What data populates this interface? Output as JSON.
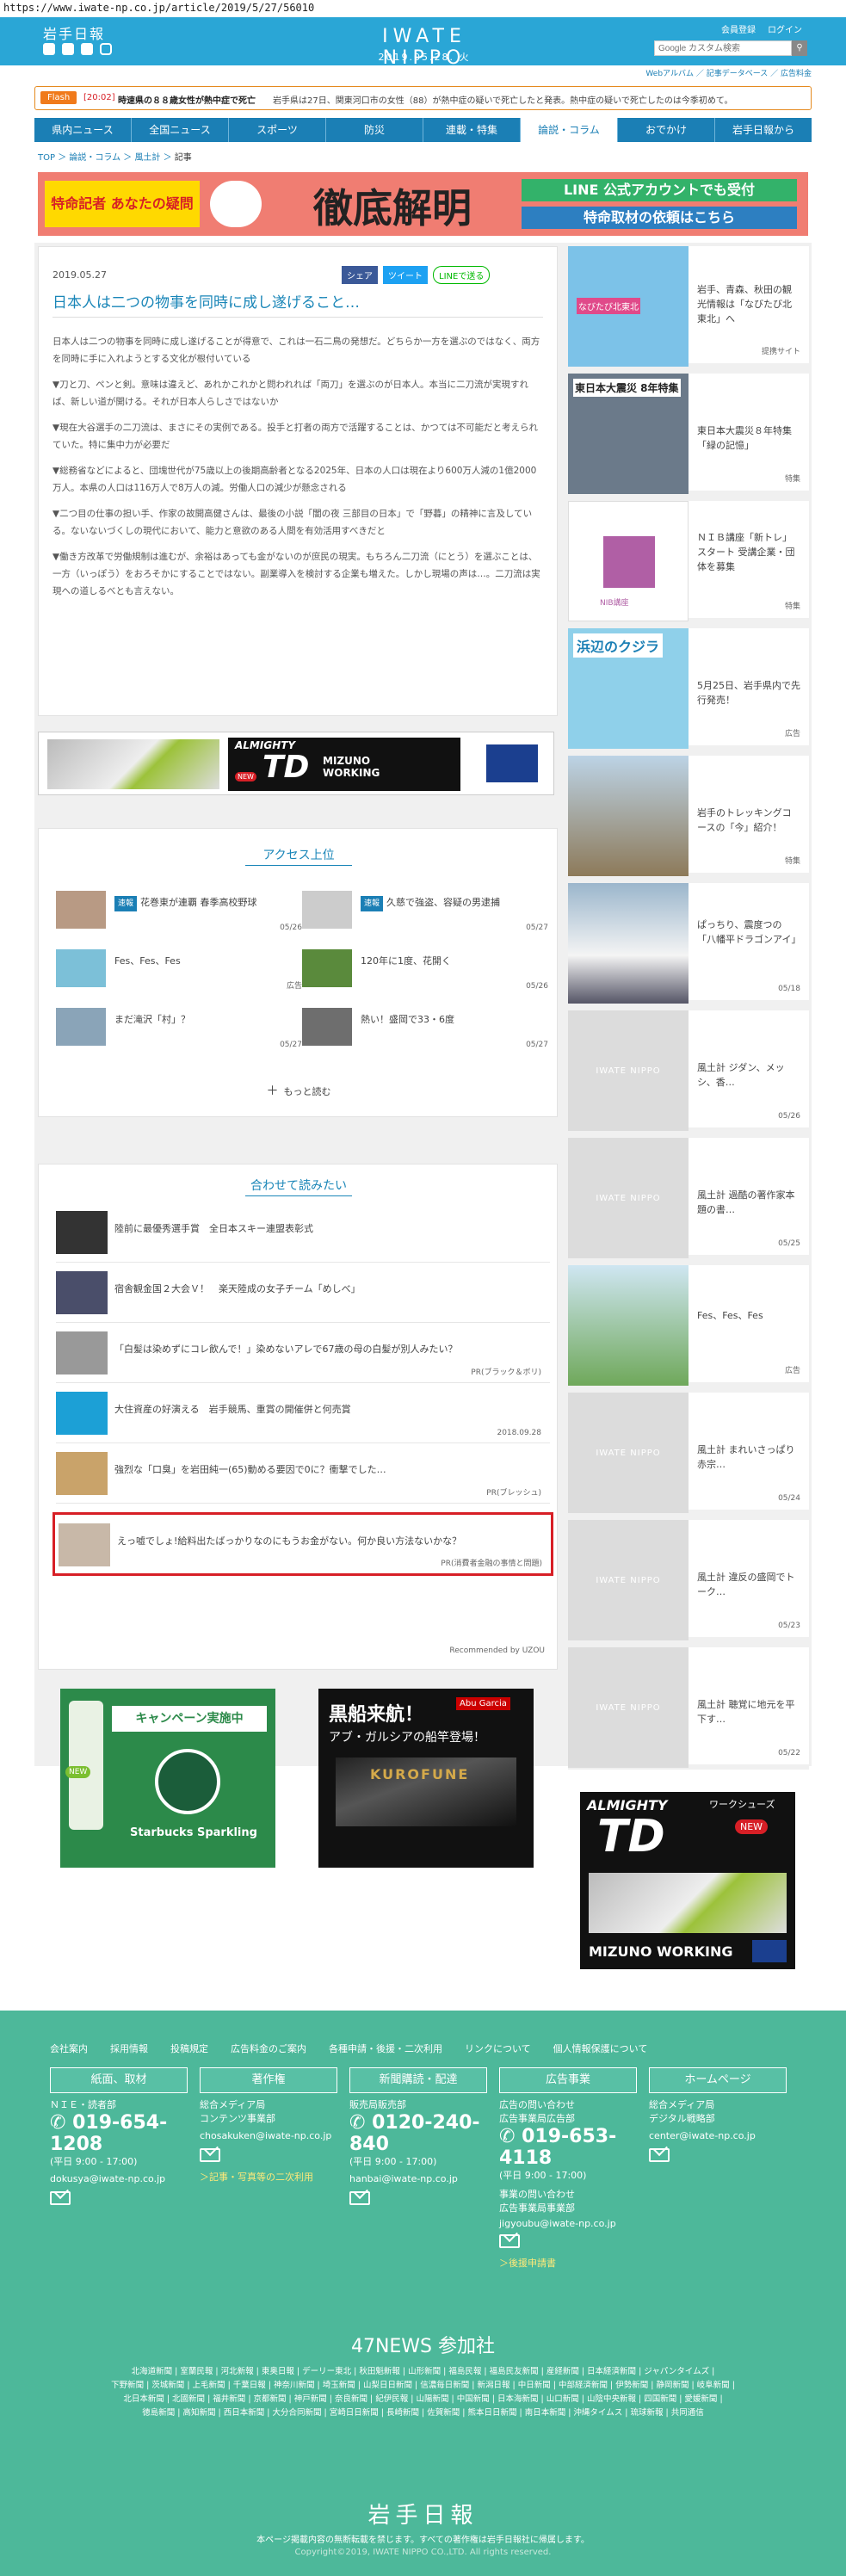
{
  "url": "https://www.iwate-np.co.jp/article/2019/5/27/56010",
  "header": {
    "logo_jp": "岩手日報",
    "logo_en": "IWATE NIPPO",
    "date": "2019.05.28. 火",
    "links": [
      "会員登録",
      "ログイン"
    ],
    "search_placeholder": "Google カスタム検索",
    "sub_links": [
      "Webアルバム",
      "記事データベース",
      "広告料金"
    ]
  },
  "flash": {
    "badge": "Flash",
    "time": "[20:02]",
    "headline": "時速県の８８歳女性が熱中症で死亡",
    "body": "岩手県は27日、関東河口市の女性（88）が熱中症の疑いで死亡したと発表。熱中症の疑いで死亡したのは今季初めて。"
  },
  "nav": [
    "県内ニュース",
    "全国ニュース",
    "スポーツ",
    "防災",
    "連載・特集",
    "論説・コラム",
    "おでかけ",
    "岩手日報から"
  ],
  "breadcrumb": [
    "TOP",
    "論説・コラム",
    "風土計",
    "記事"
  ],
  "banner": {
    "left": "特命記者 あなたの疑問",
    "center": "徹底解明",
    "line1": "LINE 公式アカウントでも受付",
    "line2": "特命取材の依頼はこちら"
  },
  "article": {
    "date": "2019.05.27",
    "share": [
      "シェア",
      "ツイート",
      "LINEで送る"
    ],
    "title": "日本人は二つの物事を同時に成し遂げること…",
    "paragraphs": [
      "日本人は二つの物事を同時に成し遂げることが得意で、これは一石二鳥の発想だ。どちらか一方を選ぶのではなく、両方を同時に手に入れようとする文化が根付いている",
      "▼刀と刀、ペンと剣。意味は違えど、あれかこれかと問われれば「両刀」を選ぶのが日本人。本当に二刀流が実現すれば、新しい道が開ける。それが日本人らしさではないか",
      "▼現在大谷選手の二刀流は、まさにその実例である。投手と打者の両方で活躍することは、かつては不可能だと考えられていた。特に集中力が必要だ",
      "▼総務省などによると、団塊世代が75歳以上の後期高齢者となる2025年、日本の人口は現在より600万人減の1億2000万人。本県の人口は116万人で8万人の減。労働人口の減少が懸念される",
      "▼二つ目の仕事の担い手、作家の故開高健さんは、最後の小説「闇の夜 三部目の日本」で「野暮」の精神に言及している。ないないづくしの現代において、能力と意欲のある人間を有効活用すべきだと",
      "▼働き方改革で労働規制は進むが、余裕はあっても金がないのが庶民の現実。もちろん二刀流（にとう）を選ぶことは、一方（いっぽう）をおろそかにすることではない。副業導入を検討する企業も増えた。しかし現場の声は…。二刀流は実現への道しるべとも言えない。"
    ]
  },
  "ad1": {
    "brand": "ALMIGHTY",
    "model": "TD",
    "sub": "ワークシューズ",
    "maker": "MIZUNO WORKING",
    "badge": "NEW"
  },
  "access": {
    "title": "アクセス上位",
    "items": [
      {
        "tag": "速報",
        "text": "花巻東が連覇 春季高校野球",
        "date": "05/26"
      },
      {
        "tag": "速報",
        "text": "久慈で強盗、容疑の男逮捕",
        "date": "05/27"
      },
      {
        "tag": "",
        "text": "Fes、Fes、Fes",
        "date": "広告"
      },
      {
        "tag": "",
        "text": "120年に1度、花開く",
        "date": "05/26"
      },
      {
        "tag": "",
        "text": "まだ滝沢「村」？",
        "date": "05/27"
      },
      {
        "tag": "",
        "text": "熱い！盛岡で33・6度",
        "date": "05/27"
      }
    ],
    "more": "もっと読む"
  },
  "recommend": {
    "title": "合わせて読みたい",
    "items": [
      {
        "text": "陸前に最優秀選手賞　全日本スキー連盟表彰式",
        "meta": ""
      },
      {
        "text": "宿舎観金国２大会Ｖ！　楽天陸成の女子チーム「めしべ」",
        "meta": ""
      },
      {
        "text": "「白髪は染めずにコレ飲んで！」染めないアレで67歳の母の白髪が別人みたい？",
        "meta": "PR(ブラック＆ボリ)"
      },
      {
        "text": "大住資産の好演える　岩手競馬、重賞の開催併と何売賞",
        "meta": "2018.09.28"
      },
      {
        "text": "強烈な「口臭」を岩田純一(65)動める要因で0に？衝撃でした…",
        "meta": "PR(ブレッシュ)"
      },
      {
        "text": "えっ嘘でしょ!給料出たばっかりなのにもうお金がない。何か良い方法ないかな？",
        "meta": "PR(消費者金融の事情と問題)"
      }
    ],
    "powered": "Recommended by UZOU"
  },
  "bottom_ads": [
    {
      "campaign": "キャンペーン実施中",
      "product": "Starbucks Sparkling",
      "badge": "NEW"
    },
    {
      "headline": "黒船来航！",
      "sub": "アブ・ガルシアの船竿登場！",
      "brand": "KUROFUNE",
      "maker": "Abu Garcia"
    }
  ],
  "sidebar": {
    "items": [
      {
        "text": "岩手、青森、秋田の観光情報は「なびたび北東北」へ",
        "meta": "提携サイト"
      },
      {
        "text": "東日本大震災８年特集「緑の記憶」",
        "meta": "特集"
      },
      {
        "text": "ＮＩＢ講座「新トレ」スタート 受講企業・団体を募集",
        "meta": "特集"
      },
      {
        "text": "5月25日、岩手県内で先行発売！",
        "meta": "広告"
      },
      {
        "text": "岩手のトレッキングコースの「今」紹介！",
        "meta": "特集"
      },
      {
        "text": "ぱっちり、震度つの「八幡平ドラゴンアイ」",
        "meta": "05/18"
      },
      {
        "text": "風土計 ジダン、メッシ、香…",
        "meta": "05/26"
      },
      {
        "text": "風土計 過酷の著作家本題の書…",
        "meta": "05/25"
      },
      {
        "text": "Fes、Fes、Fes",
        "meta": "広告"
      },
      {
        "text": "風土計 まれいさっぱり赤宗…",
        "meta": "05/24"
      },
      {
        "text": "風土計 違反の盛岡でトーク…",
        "meta": "05/23"
      },
      {
        "text": "風土計 聴覚に地元を平下す…",
        "meta": "05/22"
      }
    ],
    "thumb_labels": [
      "なびたび北東北",
      "東日本大震災 8年特集",
      "NIB講座",
      "浜辺のクジラ"
    ],
    "placeholder_text": "IWATE NIPPO",
    "ad": {
      "brand": "ALMIGHTY",
      "model": "TD",
      "sub": "ワークシューズ",
      "maker": "MIZUNO WORKING",
      "badge": "NEW"
    }
  },
  "footer": {
    "links": [
      "会社案内",
      "採用情報",
      "投稿規定",
      "広告料金のご案内",
      "各種申請・後援・二次利用",
      "リンクについて",
      "個人情報保護について"
    ],
    "columns": [
      {
        "head": "紙面、取材",
        "sub": "ＮＩＥ・読者部",
        "phone": "019-654-1208",
        "hours": "(平日 9:00 - 17:00)",
        "email": "dokusya@iwate-np.co.jp",
        "extra": ""
      },
      {
        "head": "著作権",
        "sub": "総合メディア局\nコンテンツ事業部",
        "phone": "",
        "hours": "",
        "email": "chosakuken@iwate-np.co.jp",
        "extra": "＞記事・写真等の二次利用"
      },
      {
        "head": "新聞購読・配達",
        "sub": "販売局販売部",
        "phone": "0120-240-840",
        "hours": "(平日 9:00 - 17:00)",
        "email": "hanbai@iwate-np.co.jp",
        "extra": ""
      },
      {
        "head": "広告事業",
        "sub": "広告の問い合わせ\n広告事業局広告部",
        "phone": "019-653-4118",
        "hours": "(平日 9:00 - 17:00)",
        "email": "jigyoubu@iwate-np.co.jp",
        "extra": "＞後援申請書",
        "sub2": "事業の問い合わせ\n広告事業局事業部"
      },
      {
        "head": "ホームページ",
        "sub": "総合メディア局\nデジタル戦略部",
        "phone": "",
        "hours": "",
        "email": "center@iwate-np.co.jp",
        "extra": ""
      }
    ],
    "news47_title": "47NEWS 参加社",
    "news47": [
      "北海道新聞 | 室蘭民報 | 河北新報 | 東奥日報 | デーリー東北 | 秋田魁新報 | 山形新聞 | 福島民報 | 福島民友新聞 | 産経新聞 | 日本経済新聞 | ジャパンタイムズ |",
      "下野新聞 | 茨城新聞 | 上毛新聞 | 千葉日報 | 神奈川新聞 | 埼玉新聞 | 山梨日日新聞 | 信濃毎日新聞 | 新潟日報 | 中日新聞 | 中部経済新聞 | 伊勢新聞 | 静岡新聞 | 岐阜新聞 |",
      "北日本新聞 | 北國新聞 | 福井新聞 | 京都新聞 | 神戸新聞 | 奈良新聞 | 紀伊民報 | 山陽新聞 | 中国新聞 | 日本海新聞 | 山口新聞 | 山陰中央新報 | 四国新聞 | 愛媛新聞 |",
      "徳島新聞 | 高知新聞 | 西日本新聞 | 大分合同新聞 | 宮崎日日新聞 | 長崎新聞 | 佐賀新聞 | 熊本日日新聞 | 南日本新聞 | 沖縄タイムス | 琉球新報 | 共同通信"
    ],
    "logo": "岩手日報",
    "notice": "本ページ掲載内容の無断転載を禁じます。すべての著作権は岩手日報社に帰属します。",
    "copyright": "Copyright©2019, IWATE NIPPO CO.,LTD. All rights reserved."
  },
  "colors": {
    "brand": "#2aa6d6",
    "nav": "#1b7fb5",
    "footer": "#4db89a",
    "accent_red": "#d71f26"
  }
}
